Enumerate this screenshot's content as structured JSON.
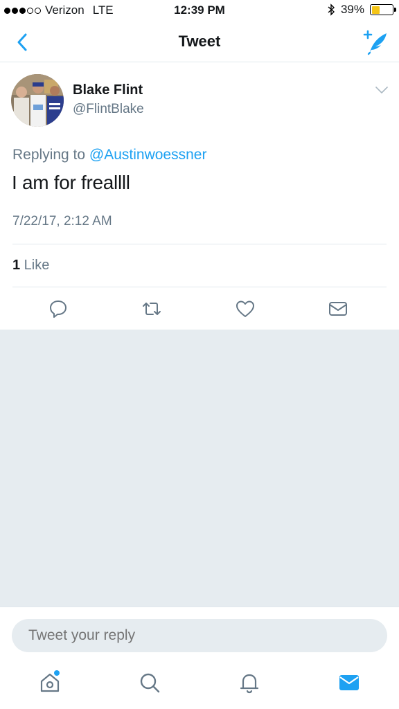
{
  "status_bar": {
    "carrier": "Verizon",
    "network": "LTE",
    "time": "12:39 PM",
    "battery_percent": "39%",
    "battery_level": 0.39,
    "signal_bars_filled": 3,
    "signal_bars_total": 5
  },
  "nav": {
    "title": "Tweet",
    "back_icon": "chevron-left-icon",
    "compose_icon": "compose-tweet-icon"
  },
  "tweet": {
    "author_name": "Blake Flint",
    "author_handle": "@FlintBlake",
    "replying_prefix": "Replying to ",
    "replying_to": "@Austinwoessner",
    "text": "I am for freallll",
    "timestamp": "7/22/17, 2:12 AM",
    "like_count": "1",
    "like_label": " Like"
  },
  "actions": [
    "reply-icon",
    "retweet-icon",
    "like-icon",
    "direct-message-icon"
  ],
  "reply": {
    "placeholder": "Tweet your reply"
  },
  "tabs": [
    "home-icon",
    "search-icon",
    "notifications-icon",
    "messages-icon"
  ],
  "colors": {
    "accent": "#1da1f2",
    "secondary_text": "#657786",
    "background_gray": "#e6ecf0",
    "battery": "#f5c516"
  }
}
